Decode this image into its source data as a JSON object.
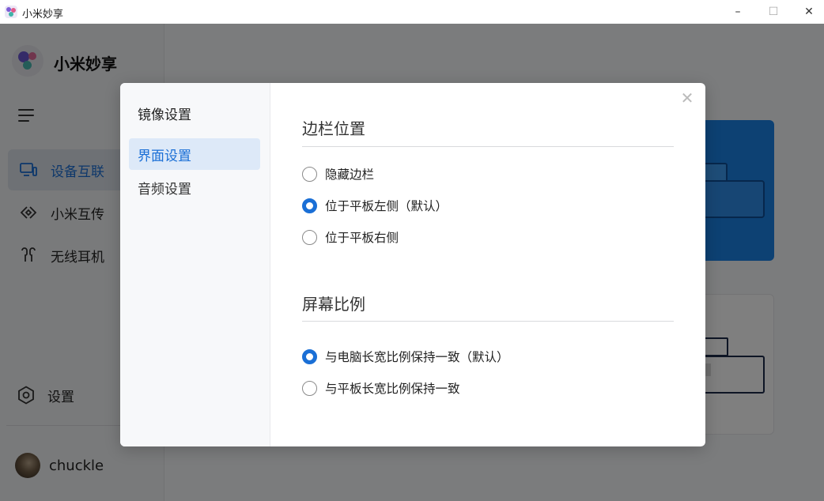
{
  "window": {
    "title": "小米妙享",
    "minimize": "–",
    "maximize": "☐",
    "close": "✕"
  },
  "sidebar": {
    "brand": "小米妙享",
    "items": [
      {
        "label": "设备互联",
        "icon": "devices-icon",
        "active": true
      },
      {
        "label": "小米互传",
        "icon": "transfer-icon",
        "active": false
      },
      {
        "label": "无线耳机",
        "icon": "earbuds-icon",
        "active": false
      }
    ],
    "settings_label": "设置",
    "user_name": "chuckle"
  },
  "dialog": {
    "title": "镜像设置",
    "nav": [
      {
        "label": "界面设置",
        "active": true
      },
      {
        "label": "音频设置",
        "active": false
      }
    ],
    "close": "✕",
    "sections": [
      {
        "title": "边栏位置",
        "options": [
          {
            "label": "隐藏边栏",
            "checked": false
          },
          {
            "label": "位于平板左侧（默认）",
            "checked": true
          },
          {
            "label": "位于平板右侧",
            "checked": false
          }
        ]
      },
      {
        "title": "屏幕比例",
        "options": [
          {
            "label": "与电脑长宽比例保持一致（默认）",
            "checked": true
          },
          {
            "label": "与平板长宽比例保持一致",
            "checked": false
          }
        ]
      }
    ]
  },
  "colors": {
    "accent": "#1a6fd6",
    "card_blue": "#1b82e6"
  }
}
